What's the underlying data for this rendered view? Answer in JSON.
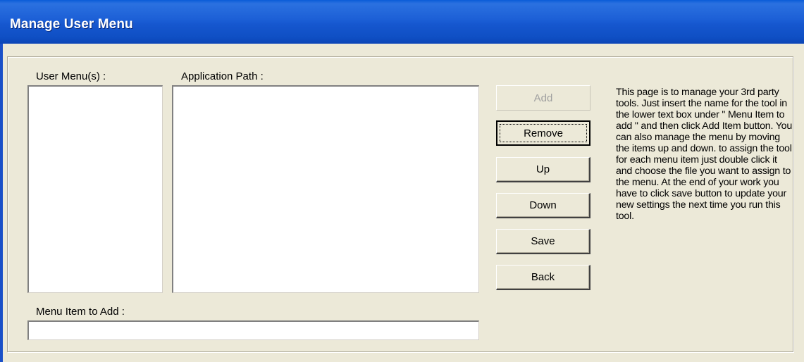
{
  "window": {
    "title": "Manage User Menu"
  },
  "labels": {
    "user_menus": "User Menu(s) :",
    "application_path": "Application Path :",
    "menu_item_to_add": "Menu Item to Add :"
  },
  "inputs": {
    "menu_item_value": ""
  },
  "buttons": {
    "add": "Add",
    "remove": "Remove",
    "up": "Up",
    "down": "Down",
    "save": "Save",
    "back": "Back"
  },
  "help": {
    "text": "This page is to manage your 3rd party tools. Just  insert the name for the tool in the lower text box under \" Menu Item to add \" and then click Add Item button. You can also manage the menu by moving the items up and down. to assign the tool for each menu item just double click it and choose the file you want to assign to the menu. At the end of your work you have to click save button to update your new settings the next time you run this tool."
  },
  "colors": {
    "titlebar": "#1657cf",
    "face": "#ece9d8",
    "disabled_text": "#a0a0a0"
  }
}
